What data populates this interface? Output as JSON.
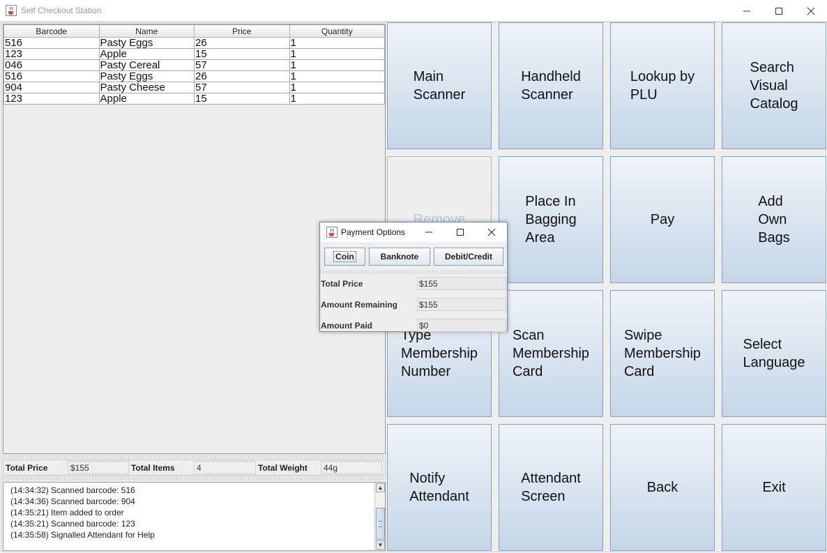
{
  "window": {
    "title": "Self Checkout Station",
    "app_icon": "java-coffee-icon"
  },
  "table": {
    "columns": [
      "Barcode",
      "Name",
      "Price",
      "Quantity"
    ],
    "rows": [
      [
        "516",
        "Pasty Eggs",
        "26",
        "1"
      ],
      [
        "123",
        "Apple",
        "15",
        "1"
      ],
      [
        "046",
        "Pasty Cereal",
        "57",
        "1"
      ],
      [
        "516",
        "Pasty Eggs",
        "26",
        "1"
      ],
      [
        "904",
        "Pasty Cheese",
        "57",
        "1"
      ],
      [
        "123",
        "Apple",
        "15",
        "1"
      ]
    ]
  },
  "totals": {
    "total_price_label": "Total Price",
    "total_price": "$155",
    "total_items_label": "Total Items",
    "total_items": "4",
    "total_weight_label": "Total Weight",
    "total_weight": "44g"
  },
  "log": [
    "(14:34:32) Scanned barcode: 516",
    "(14:34:36) Scanned barcode: 904",
    "(14:35:21) Item added to order",
    "(14:35:21) Scanned barcode:  123",
    "(14:35:58) Signalled Attendant for Help"
  ],
  "buttons": {
    "main_scanner": "Main\nScanner",
    "handheld_scanner": "Handheld\nScanner",
    "lookup_plu": "Lookup by\nPLU",
    "search_catalog": "Search\nVisual\nCatalog",
    "remove": "Remove",
    "place_bagging": "Place In\nBagging\nArea",
    "pay": "Pay",
    "add_bags": "Add\nOwn\nBags",
    "type_membership": "Type\nMembership\nNumber",
    "scan_membership": "Scan\nMembership\nCard",
    "swipe_membership": "Swipe\nMembership\nCard",
    "select_language": "Select\nLanguage",
    "notify_attendant": "Notify\nAttendant",
    "attendant_screen": "Attendant\nScreen",
    "back": "Back",
    "exit": "Exit"
  },
  "payment_dialog": {
    "title": "Payment Options",
    "coin": "Coin",
    "banknote": "Banknote",
    "debit_credit": "Debit/Credit",
    "total_price_label": "Total Price",
    "total_price": "$155",
    "amount_remaining_label": "Amount Remaining",
    "amount_remaining": "$155",
    "amount_paid_label": "Amount Paid",
    "amount_paid": "$0"
  }
}
